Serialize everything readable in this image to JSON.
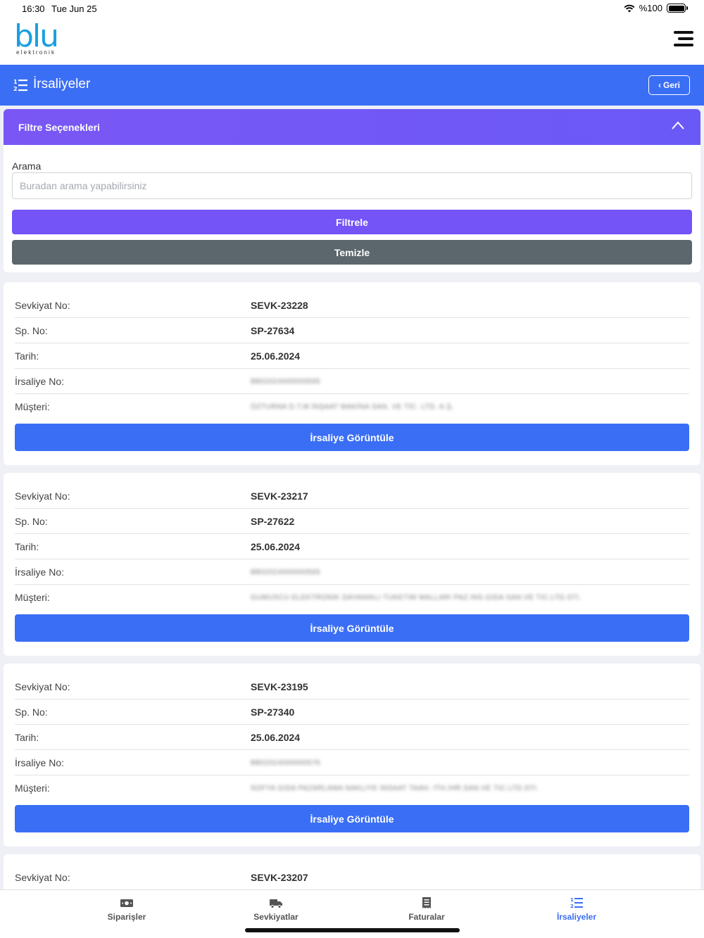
{
  "status_bar": {
    "time": "16:30",
    "date": "Tue Jun 25",
    "battery": "%100"
  },
  "brand": {
    "logo": "blu",
    "logo_sub": "elektronik",
    "accent": "#1aa0e0"
  },
  "page": {
    "title": "İrsaliyeler",
    "back_label": "Geri",
    "header_color": "#3a6ef5"
  },
  "filter": {
    "header": "Filtre Seçenekleri",
    "search_label": "Arama",
    "search_placeholder": "Buradan arama yapabilirsiniz",
    "search_value": "",
    "filter_button": "Filtrele",
    "clear_button": "Temizle",
    "accent": "#7453f7"
  },
  "labels": {
    "shipment_no": "Sevkiyat No:",
    "order_no": "Sp. No:",
    "date": "Tarih:",
    "waybill_no": "İrsaliye No:",
    "customer": "Müşteri:",
    "view_button": "İrsaliye Görüntüle"
  },
  "records": [
    {
      "shipment_no": "SEVK-23228",
      "order_no": "SP-27634",
      "date": "25.06.2024",
      "waybill_no": "BB02024000000565",
      "customer": "ÖZTURNA D.T.M İNŞAAT MAKİNA SAN. VE TİC. LTD. A.Ş."
    },
    {
      "shipment_no": "SEVK-23217",
      "order_no": "SP-27622",
      "date": "25.06.2024",
      "waybill_no": "BB02024000000565",
      "customer": "GUMUSCU ELEKTRONIK DAYANIKLI TUKETIM MALLARI PAZ.INS.GIDA SAN.VE TIC.LTD.STI."
    },
    {
      "shipment_no": "SEVK-23195",
      "order_no": "SP-27340",
      "date": "25.06.2024",
      "waybill_no": "BB02024000000576",
      "customer": "SOFYA GIDA PAZARLAMA NAKLIYE INSAAT TAAH. ITH.IHR.SAN.VE TIC.LTD.STI."
    },
    {
      "shipment_no": "SEVK-23207"
    }
  ],
  "bottom_nav": [
    {
      "label": "Siparişler",
      "icon": "money-icon",
      "active": false
    },
    {
      "label": "Sevkiyatlar",
      "icon": "truck-icon",
      "active": false
    },
    {
      "label": "Faturalar",
      "icon": "receipt-icon",
      "active": false
    },
    {
      "label": "İrsaliyeler",
      "icon": "ordered-list-icon",
      "active": true
    }
  ]
}
